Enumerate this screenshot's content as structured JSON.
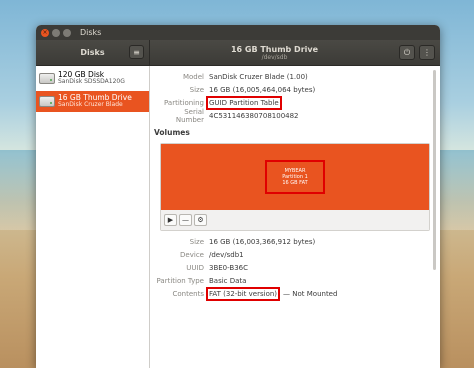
{
  "window": {
    "title": "Disks"
  },
  "sidebar_header": {
    "title": "Disks"
  },
  "header": {
    "title": "16 GB Thumb Drive",
    "subtitle": "/dev/sdb"
  },
  "disks": [
    {
      "name": "120 GB Disk",
      "sub": "SanDisk SDSSDA120G"
    },
    {
      "name": "16 GB Thumb Drive",
      "sub": "SanDisk Cruzer Blade"
    }
  ],
  "drive_info": {
    "model_label": "Model",
    "model_value": "SanDisk Cruzer Blade (1.00)",
    "size_label": "Size",
    "size_value": "16 GB (16,005,464,064 bytes)",
    "partitioning_label": "Partitioning",
    "partitioning_value": "GUID Partition Table",
    "serial_label": "Serial Number",
    "serial_value": "4C531146380708100482"
  },
  "volumes": {
    "title": "Volumes",
    "partition": {
      "name": "MYBEAR",
      "number": "Partition 1",
      "desc": "16 GB FAT"
    },
    "tools": {
      "play": "▶",
      "minus": "—",
      "settings": "⚙"
    }
  },
  "partition_info": {
    "size_label": "Size",
    "size_value": "16 GB (16,003,366,912 bytes)",
    "device_label": "Device",
    "device_value": "/dev/sdb1",
    "uuid_label": "UUID",
    "uuid_value": "3BE0-B36C",
    "type_label": "Partition Type",
    "type_value": "Basic Data",
    "contents_label": "Contents",
    "contents_value": "FAT (32-bit version)",
    "contents_suffix": "— Not Mounted"
  },
  "icons": {
    "close": "×",
    "menu": "≡",
    "power": "⏻",
    "more": "⋮"
  },
  "colors": {
    "accent": "#e95420",
    "titlebar": "#3c3b37",
    "highlight": "#e00000"
  }
}
